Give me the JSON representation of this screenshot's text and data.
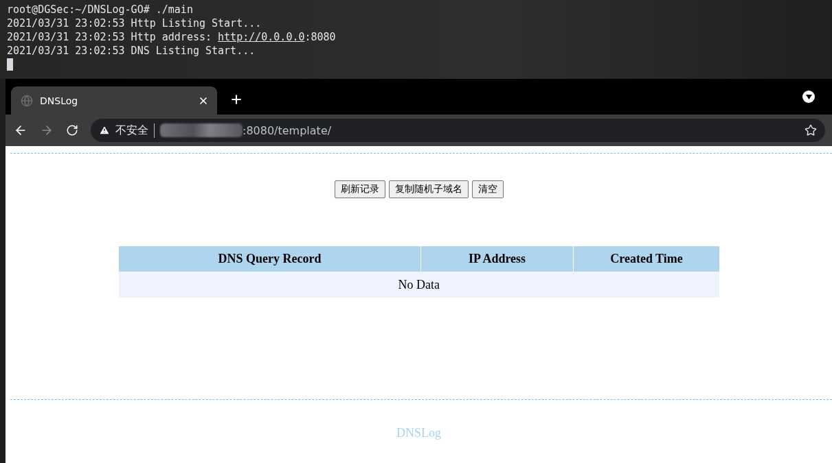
{
  "terminal": {
    "lines": [
      {
        "text": "root@DGSec:~/DNSLog-GO# ./main"
      },
      {
        "text": "2021/03/31 23:02:53 Http Listing Start..."
      },
      {
        "text": "2021/03/31 23:02:53 Http address: ",
        "link": "http://0.0.0.0",
        "after": ":8080"
      },
      {
        "text": "2021/03/31 23:02:53 DNS Listing Start..."
      }
    ]
  },
  "browser": {
    "tab": {
      "title": "DNSLog",
      "selected": true
    },
    "address": {
      "security": "不安全",
      "url": ":8080/template/"
    }
  },
  "page": {
    "buttons": [
      "刷新记录",
      "复制随机子域名",
      "清空"
    ],
    "table": {
      "columns": [
        "DNS Query Record",
        "IP Address",
        "Created Time"
      ],
      "empty_text": "No Data"
    },
    "footer": "DNSLog"
  }
}
